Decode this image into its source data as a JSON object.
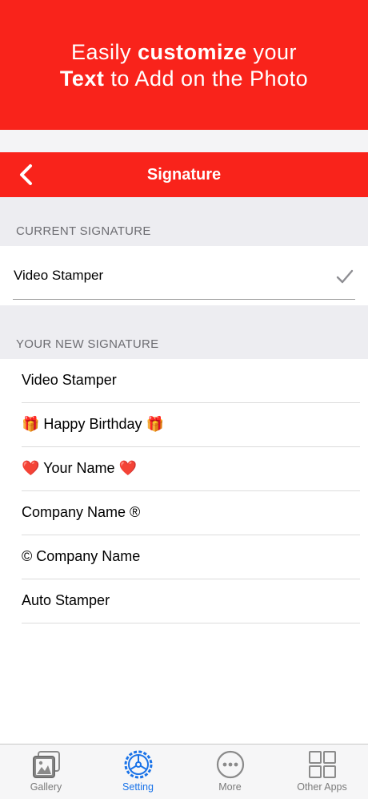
{
  "promo": {
    "line1_pre": "Easily ",
    "line1_bold": "customize",
    "line1_post": " your",
    "line2_bold": "Text",
    "line2_post": " to Add on the Photo"
  },
  "navbar": {
    "title": "Signature",
    "back_icon": "chevron-left-icon"
  },
  "current_section": {
    "header": "CURRENT SIGNATURE",
    "value": "Video Stamper",
    "check_icon": "checkmark-icon"
  },
  "new_section": {
    "header": "YOUR NEW SIGNATURE",
    "items": [
      {
        "label": "Video Stamper"
      },
      {
        "label": "🎁 Happy Birthday 🎁"
      },
      {
        "label": "❤️ Your Name ❤️"
      },
      {
        "label": "Company Name ®"
      },
      {
        "label": "© Company Name"
      },
      {
        "label": "Auto Stamper"
      }
    ]
  },
  "tabbar": {
    "tabs": [
      {
        "label": "Gallery",
        "icon": "gallery-icon"
      },
      {
        "label": "Setting",
        "icon": "gear-icon",
        "active": true
      },
      {
        "label": "More",
        "icon": "more-icon"
      },
      {
        "label": "Other Apps",
        "icon": "grid-icon"
      }
    ]
  },
  "colors": {
    "brand_red": "#f9231b",
    "active_blue": "#1a73e8"
  }
}
